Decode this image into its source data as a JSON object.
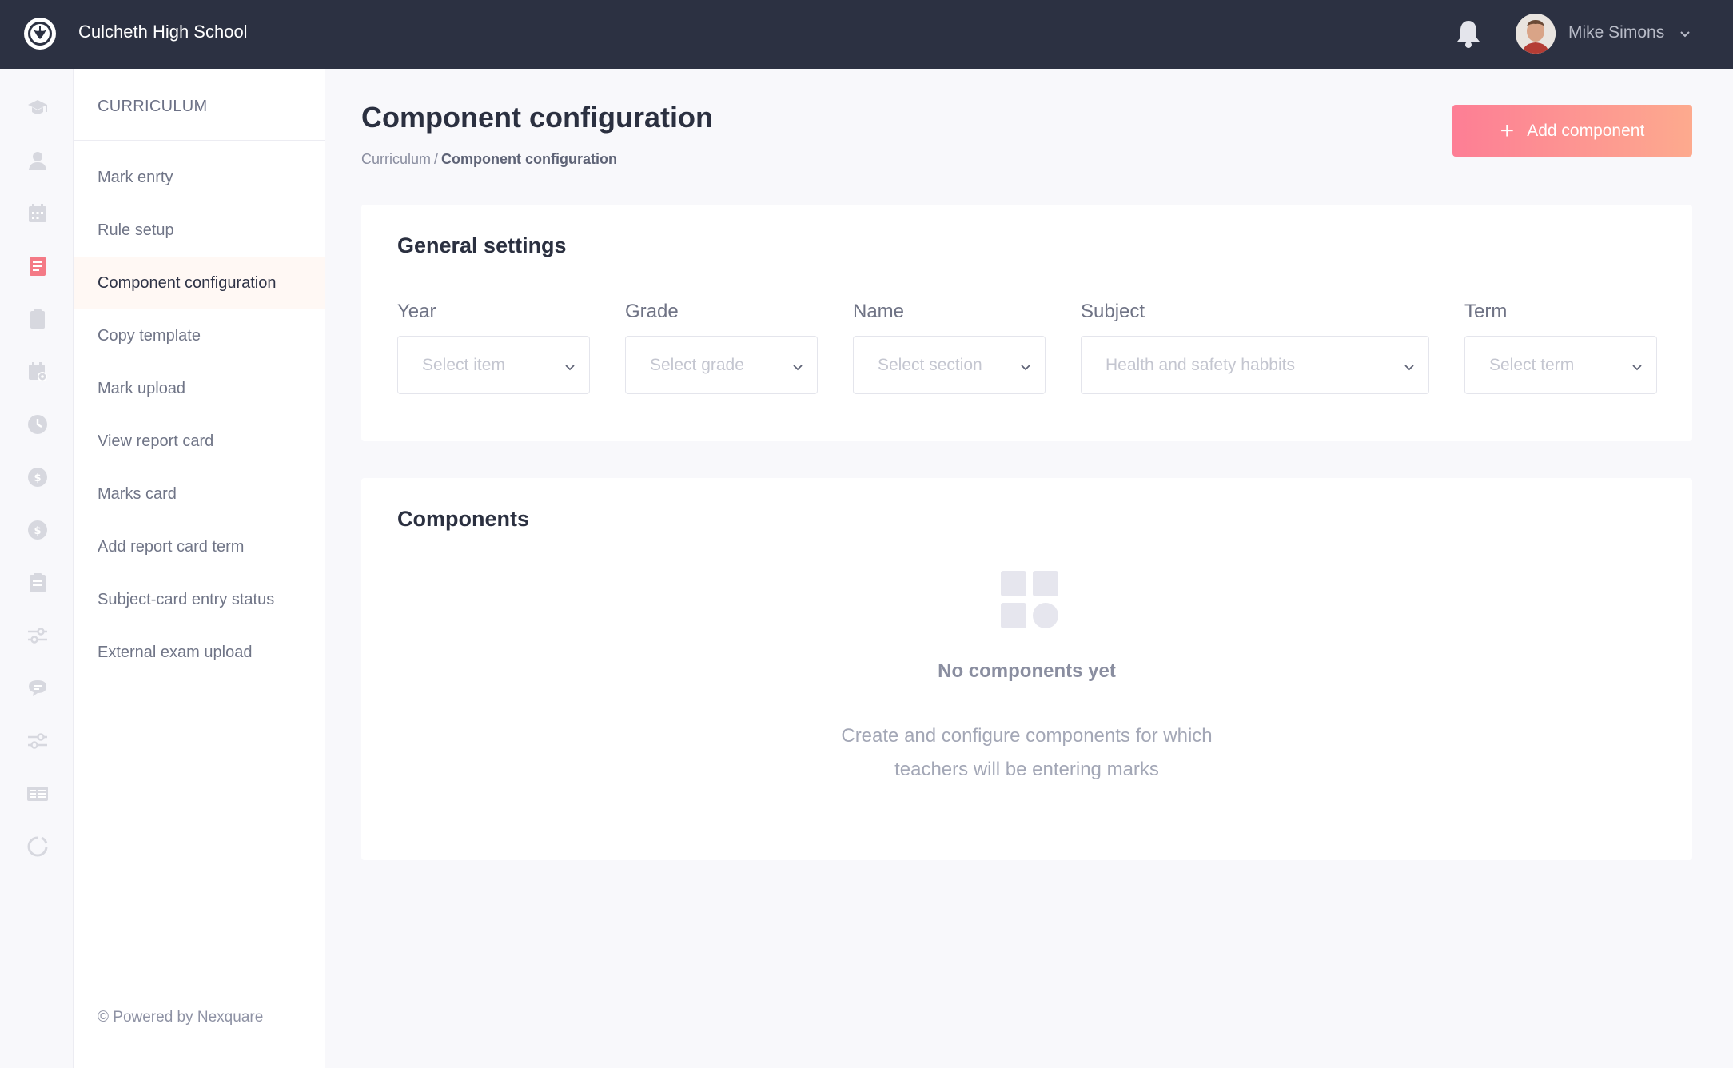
{
  "header": {
    "school_name": "Culcheth High School",
    "user_name": "Mike Simons"
  },
  "rail": {
    "icons": [
      "graduation-cap-icon",
      "person-icon",
      "calendar-icon",
      "document-icon",
      "clipboard-icon",
      "calendar-settings-icon",
      "clock-icon",
      "dollar-circle-icon",
      "dollar-circle-icon",
      "notepad-icon",
      "sliders-icon",
      "chat-icon",
      "sliders-icon",
      "id-card-icon",
      "refresh-icon"
    ],
    "active_index": 3
  },
  "subnav": {
    "header": "CURRICULUM",
    "items": [
      {
        "label": "Mark enrty"
      },
      {
        "label": "Rule setup"
      },
      {
        "label": "Component configuration"
      },
      {
        "label": "Copy template"
      },
      {
        "label": "Mark upload"
      },
      {
        "label": "View report card"
      },
      {
        "label": "Marks card"
      },
      {
        "label": "Add report card term"
      },
      {
        "label": "Subject-card entry status"
      },
      {
        "label": "External exam upload"
      }
    ],
    "active": "Component configuration",
    "footer": "© Powered by Nexquare"
  },
  "page": {
    "title": "Component configuration",
    "breadcrumb": {
      "parent": "Curriculum",
      "separator": "/",
      "current": "Component configuration"
    },
    "add_button": "Add component"
  },
  "general_settings": {
    "title": "General settings",
    "fields": [
      {
        "label": "Year",
        "value": "Select item"
      },
      {
        "label": "Grade",
        "value": "Select grade"
      },
      {
        "label": "Name",
        "value": "Select section"
      },
      {
        "label": "Subject",
        "value": "Health and safety habbits"
      },
      {
        "label": "Term",
        "value": "Select term"
      }
    ]
  },
  "components": {
    "title": "Components",
    "empty_title": "No components yet",
    "empty_desc_line1": "Create and configure components for which",
    "empty_desc_line2": "teachers will be entering marks"
  },
  "colors": {
    "topbar": "#2c3142",
    "accent_start": "#fd7e95",
    "accent_end": "#fdaa8e",
    "active_rail": "#f47a86"
  }
}
